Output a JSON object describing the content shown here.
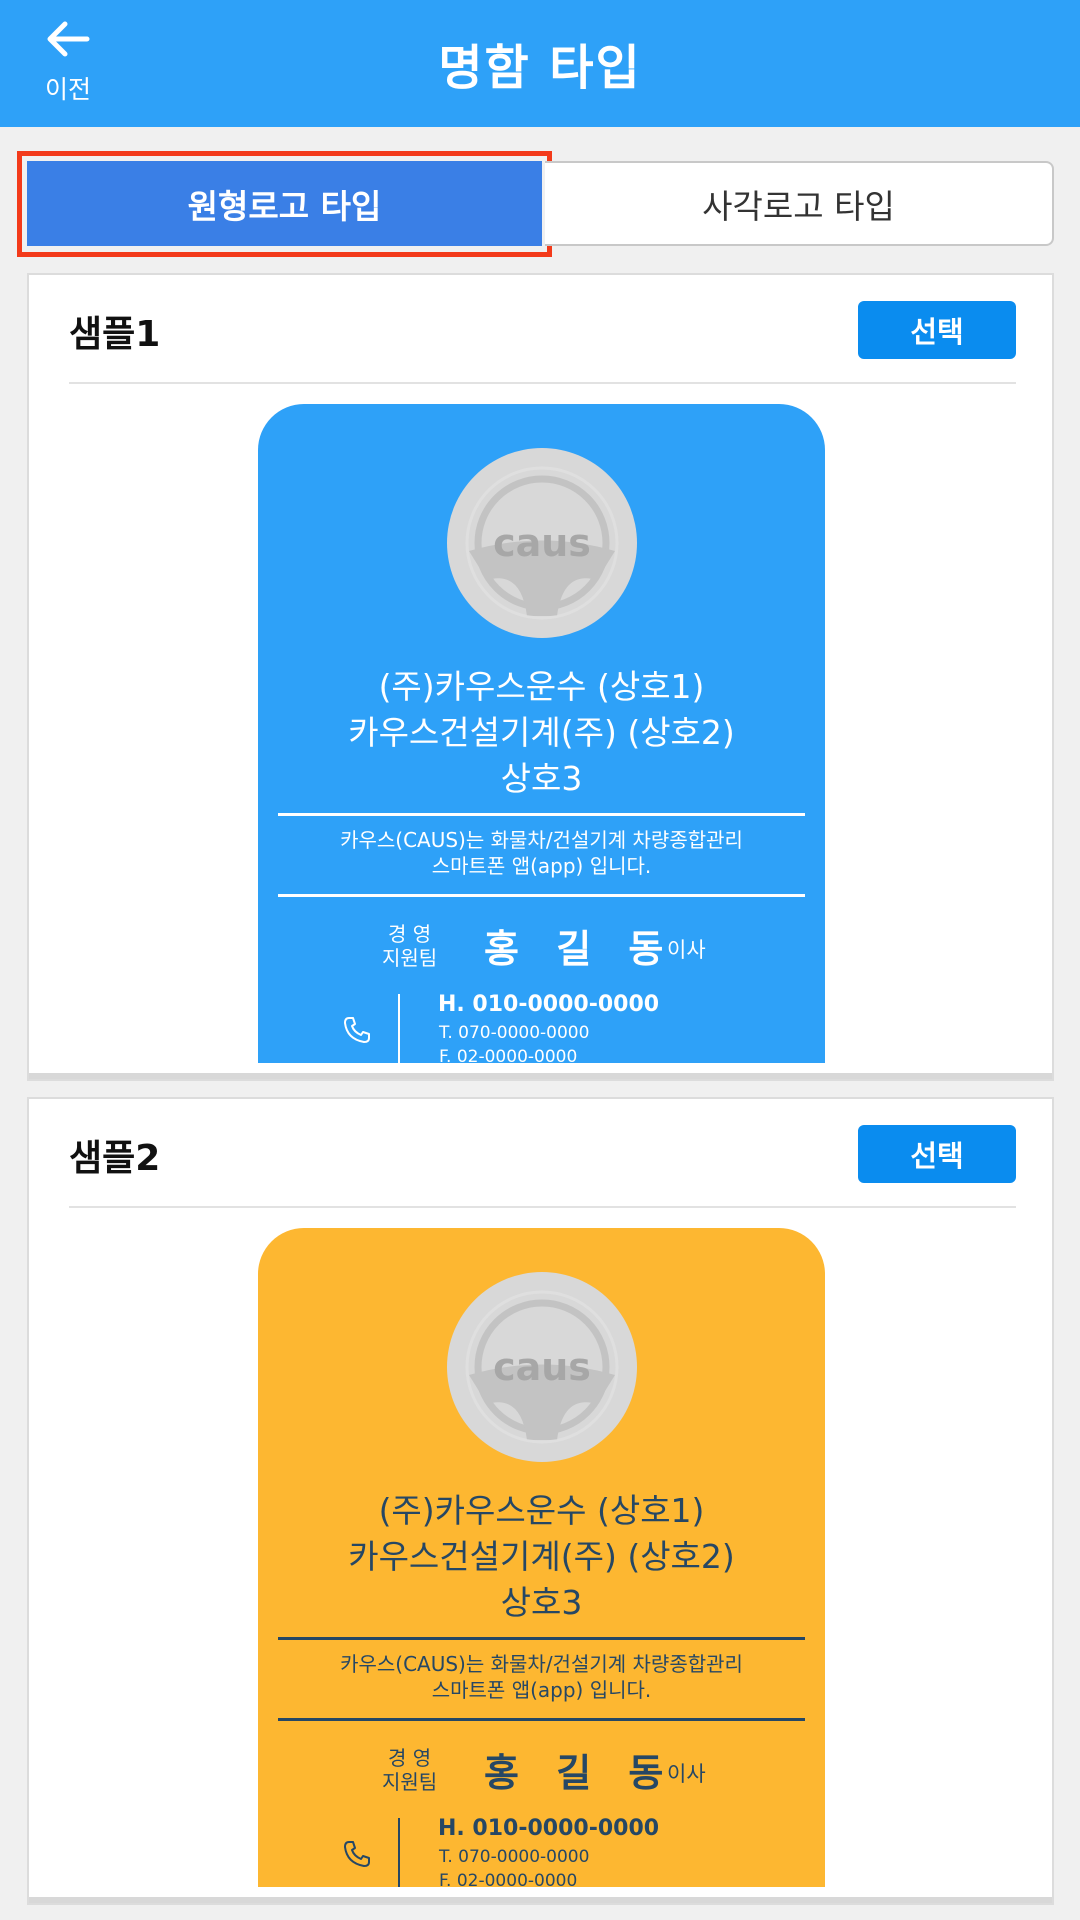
{
  "header": {
    "back_label": "이전",
    "title": "명함 타입"
  },
  "tabs": [
    {
      "label": "원형로고 타입",
      "selected": true
    },
    {
      "label": "사각로고 타입",
      "selected": false
    }
  ],
  "colors": {
    "header_bg": "#2ea1f8",
    "tab_active": "#3a7fe6",
    "focus_outline": "#f33a1a",
    "select_button": "#0a8cef",
    "card_blue": "#2ea1f8",
    "card_yellow": "#fdb731",
    "card_yellow_text": "#264764"
  },
  "samples": [
    {
      "title": "샘플1",
      "select_label": "선택",
      "card": {
        "theme": "blue",
        "logo_text": "caus",
        "company_line1": "(주)카우스운수 (상호1)",
        "company_line2": "카우스건설기계(주) (상호2)",
        "company_line3": "상호3",
        "slogan_line1": "카우스(CAUS)는 화물차/건설기계 차량종합관리",
        "slogan_line2": "스마트폰 앱(app) 입니다.",
        "dept_line1": "경 영",
        "dept_line2": "지원팀",
        "person_name": "홍 길 동",
        "role": "이사",
        "hand_phone": "H. 010-0000-0000",
        "tel": "T. 070-0000-0000",
        "fax": "F. 02-0000-0000"
      }
    },
    {
      "title": "샘플2",
      "select_label": "선택",
      "card": {
        "theme": "yellow",
        "logo_text": "caus",
        "company_line1": "(주)카우스운수 (상호1)",
        "company_line2": "카우스건설기계(주) (상호2)",
        "company_line3": "상호3",
        "slogan_line1": "카우스(CAUS)는 화물차/건설기계 차량종합관리",
        "slogan_line2": "스마트폰 앱(app) 입니다.",
        "dept_line1": "경 영",
        "dept_line2": "지원팀",
        "person_name": "홍 길 동",
        "role": "이사",
        "hand_phone": "H. 010-0000-0000",
        "tel": "T. 070-0000-0000",
        "fax": "F. 02-0000-0000"
      }
    }
  ]
}
